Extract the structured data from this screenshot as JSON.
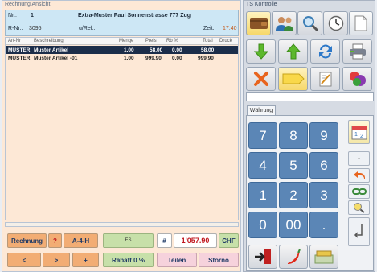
{
  "left_panel": {
    "title": "Rechnung Ansicht",
    "nr_label": "Nr.:",
    "nr_value": "1",
    "customer": "Extra-Muster Paul Sonnenstrasse 777 Zug",
    "rnr_label": "R-Nr.:",
    "rnr_value": "3095",
    "uref_label": "u/Ref.:",
    "zeit_label": "Zeit:",
    "zeit_value": "17:40",
    "columns": [
      "Art-Nr",
      "Beschreibung",
      "Menge",
      "Preis",
      "Rb %",
      "Total",
      "Druck"
    ],
    "rows": [
      {
        "artnr": "MUSTER",
        "desc": "Muster Artikel",
        "menge": "1.00",
        "preis": "58.00",
        "rb": "0.00",
        "total": "58.00"
      },
      {
        "artnr": "MUSTER",
        "desc": "Muster Artikel -01",
        "menge": "1.00",
        "preis": "999.90",
        "rb": "0.00",
        "total": "999.90"
      }
    ]
  },
  "bottom_bar": {
    "rechnung": "Rechnung",
    "question": "?",
    "a4h": "A-4-H",
    "es": "ES",
    "hash": "#",
    "total": "1'057.90",
    "currency": "CHF",
    "prev": "<",
    "next": ">",
    "plus": "+",
    "rabatt": "Rabatt 0 %",
    "teilen": "Teilen",
    "storno": "Storno"
  },
  "right_panel": {
    "title": "TS Kontrolle",
    "tab_label": "Währung",
    "keys": [
      "7",
      "8",
      "9",
      "4",
      "5",
      "6",
      "1",
      "2",
      "3",
      "0",
      "00",
      "."
    ],
    "side_minus": "-",
    "icons": {
      "row1": [
        "wallet-icon",
        "users-icon",
        "search-icon",
        "clock-icon",
        "document-icon"
      ],
      "row2": [
        "arrow-down-icon",
        "arrow-up-icon",
        "refresh-icon",
        "printer-icon"
      ],
      "row3": [
        "delete-icon",
        "tag-icon",
        "notepad-icon",
        "discount-icon"
      ]
    }
  },
  "colors": {
    "accent_orange": "#f2ad74",
    "keypad_blue": "#5b86b6",
    "selected_row": "#1b2d4a",
    "total_red": "#c0151d"
  }
}
